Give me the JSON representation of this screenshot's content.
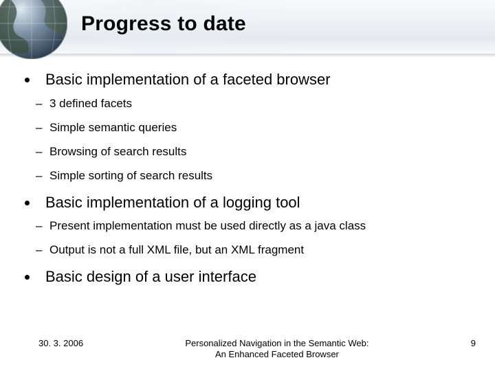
{
  "title": "Progress to date",
  "bullets": {
    "b1": {
      "text": "Basic implementation of a faceted browser",
      "sub": {
        "s1": "3 defined facets",
        "s2": "Simple semantic queries",
        "s3": "Browsing of search results",
        "s4": "Simple sorting of search results"
      }
    },
    "b2": {
      "text": "Basic implementation of a logging tool",
      "sub": {
        "s1": "Present implementation must be used directly as a java class",
        "s2": "Output is not a full XML file, but an XML fragment"
      }
    },
    "b3": {
      "text": "Basic design of a user interface"
    }
  },
  "footer": {
    "date": "30. 3. 2006",
    "center_line1": "Personalized Navigation in the Semantic Web:",
    "center_line2": "An Enhanced Faceted Browser",
    "page": "9"
  }
}
